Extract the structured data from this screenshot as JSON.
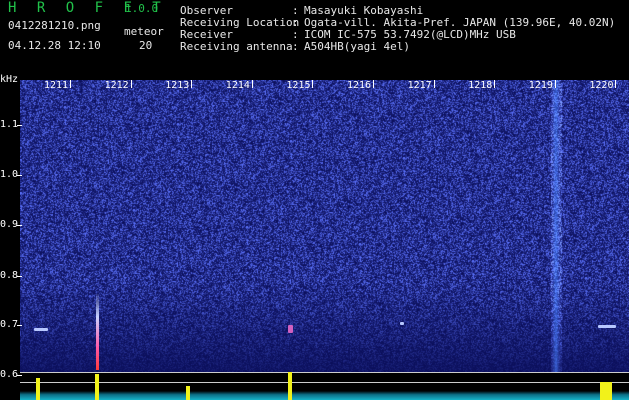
{
  "app": {
    "name": "H R O F F T",
    "version": "1.0.0"
  },
  "file": {
    "name": "0412281210.png",
    "datetime": "04.12.28 12:10"
  },
  "meteor": {
    "label": "meteor",
    "count": "20"
  },
  "info": {
    "observer_label": "Observer",
    "observer": "Masayuki Kobayashi",
    "location_label": "Receiving Location",
    "location": "Ogata-vill. Akita-Pref. JAPAN (139.96E, 40.02N)",
    "receiver_label": "Receiver",
    "receiver": "ICOM IC-575 53.7492(@LCD)MHz USB",
    "antenna_label": "Receiving antenna",
    "antenna": "A504HB(yagi 4el)",
    "colon": ":"
  },
  "axis": {
    "unit": "kHz",
    "time_ticks": [
      "1211",
      "1212",
      "1213",
      "1214",
      "1215",
      "1216",
      "1217",
      "1218",
      "1219",
      "1220"
    ],
    "freq_ticks": [
      "1.1",
      "1.0",
      "0.9",
      "0.8",
      "0.7",
      "0.6"
    ]
  },
  "colors": {
    "background": "#0a0f6a",
    "title": "#21c24a",
    "meteor_echo": "#c8d2ff",
    "signal": "#f2f21a",
    "floor": "#16b3c8"
  }
}
